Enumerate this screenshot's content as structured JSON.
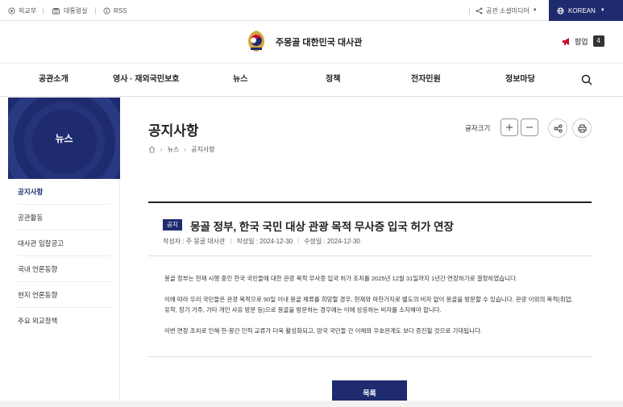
{
  "topbar": {
    "links": [
      "외교부",
      "대통령실",
      "RSS"
    ],
    "social_label": "공관 소셜미디어",
    "language": "KOREAN"
  },
  "header": {
    "site_title": "주몽골 대한민국 대사관",
    "popup_label": "팝업",
    "popup_count": "4"
  },
  "gnb": {
    "items": [
      "공관소개",
      "영사 · 재외국민보호",
      "뉴스",
      "정책",
      "전자민원",
      "정보마당"
    ]
  },
  "sidebar": {
    "title": "뉴스",
    "items": [
      "공지사항",
      "공관활동",
      "대사관 입찰공고",
      "국내 언론동향",
      "현지 언론동향",
      "주요 외교정책"
    ]
  },
  "content": {
    "page_title": "공지사항",
    "breadcrumb": [
      "뉴스",
      "공지사항"
    ],
    "font_size_label": "글자크기"
  },
  "article": {
    "tag": "공지",
    "title": "몽골 정부, 한국 국민 대상 관광 목적 무사증 입국 허가 연장",
    "author": "작성자 : 주 몽골 대사관",
    "created": "작성일 : 2024-12-30",
    "modified": "수정일 : 2024-12-30",
    "paragraphs": [
      "몽골 정부는 현재 시행 중인 한국 국민들에 대한 관광 목적 무사증 입국 허가 조치를 2025년 12월 31일까지 1년간 연장하기로 결정하였습니다.",
      "이에 따라 우리 국민들은 관광 목적으로 90일 이내 몽골 체류를 희망할 경우, 현재와 마찬가지로 별도의 비자 없이 몽골을 방문할 수 있습니다. 관광 이외의 목적(취업, 유학, 장기 거주, 기타 개인 사유 방문 등)으로 몽골을 방문하는 경우에는 이에 상응하는 비자를 소지해야 합니다.",
      "이번 연장 조치로 인해 한-몽간 인적 교류가 더욱 활성화되고, 양국 국민들 간 이해와 우호관계도 보다 증진될 것으로 기대됩니다."
    ],
    "list_button": "목록"
  },
  "colors": {
    "brand": "#1e2b6e"
  }
}
